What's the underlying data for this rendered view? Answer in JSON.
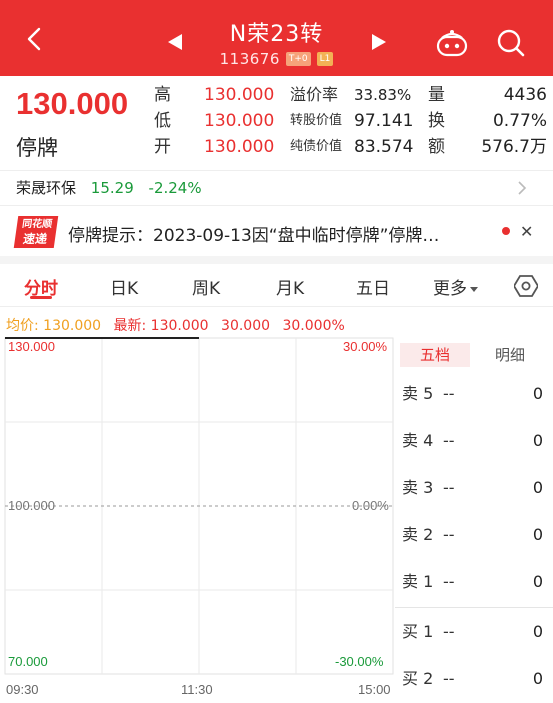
{
  "header": {
    "title": "N荣23转",
    "code": "113676",
    "badge_t0": "T+0",
    "badge_l1": "L1",
    "color": "#e93030"
  },
  "quote": {
    "price": "130.000",
    "status": "停牌",
    "high_label": "高",
    "high_value": "130.000",
    "low_label": "低",
    "low_value": "130.000",
    "open_label": "开",
    "open_value": "130.000",
    "premium_label": "溢价率",
    "premium_value": "33.83%",
    "conv_label": "转股价值",
    "conv_value": "97.141",
    "bond_label": "纯债价值",
    "bond_value": "83.574",
    "vol_label": "量",
    "vol_value": "4436",
    "turnover_label": "换",
    "turnover_value": "0.77%",
    "amount_label": "额",
    "amount_value": "576.7万"
  },
  "related": {
    "name": "荣晟环保",
    "price": "15.29",
    "change": "-2.24%"
  },
  "notice": {
    "logo_line1": "同花顺",
    "logo_line2": "速递",
    "text": "停牌提示：2023-09-13因“盘中临时停牌”停牌…"
  },
  "tabs": {
    "t1": "分时",
    "t2": "日K",
    "t3": "周K",
    "t4": "月K",
    "t5": "五日",
    "t6": "更多"
  },
  "legend": {
    "avg": "均价: 130.000",
    "latest": "最新: 130.000",
    "latest_change": "30.000",
    "latest_pct": "30.000%"
  },
  "chart": {
    "y_top": "130.000",
    "y_mid": "100.000",
    "y_bottom": "70.000",
    "pct_top": "30.00%",
    "pct_mid": "0.00%",
    "pct_bottom": "-30.00%",
    "t_start": "09:30",
    "t_mid": "11:30",
    "t_end": "15:00"
  },
  "orderbook": {
    "tab_active": "五档",
    "tab_inactive": "明细",
    "rows": [
      {
        "label": "卖 5",
        "price": "--",
        "vol": "0"
      },
      {
        "label": "卖 4",
        "price": "--",
        "vol": "0"
      },
      {
        "label": "卖 3",
        "price": "--",
        "vol": "0"
      },
      {
        "label": "卖 2",
        "price": "--",
        "vol": "0"
      },
      {
        "label": "卖 1",
        "price": "--",
        "vol": "0"
      },
      {
        "label": "买 1",
        "price": "--",
        "vol": "0"
      },
      {
        "label": "买 2",
        "price": "--",
        "vol": "0"
      }
    ]
  }
}
